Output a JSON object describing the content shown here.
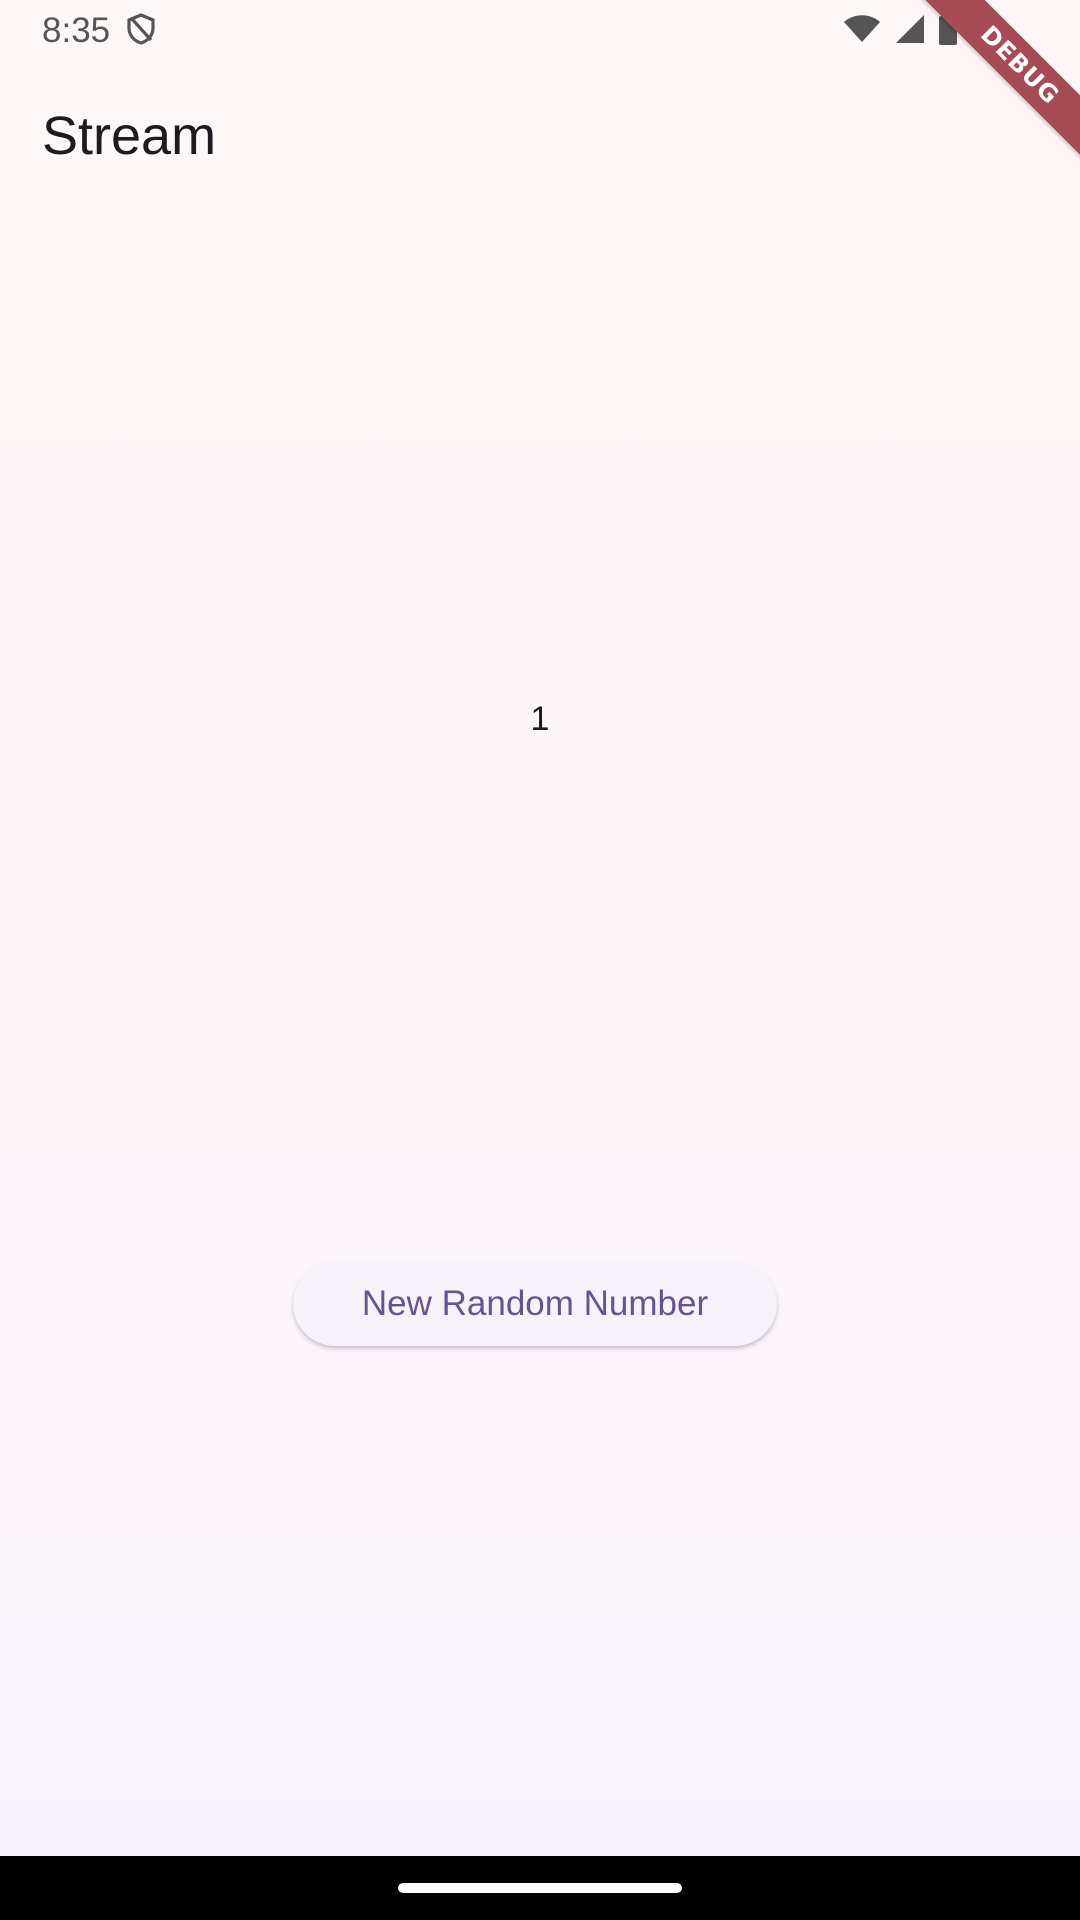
{
  "status_bar": {
    "time": "8:35",
    "icons": [
      "shield-icon",
      "wifi-icon",
      "signal-icon",
      "battery-icon"
    ]
  },
  "debug_banner": {
    "label": "DEBUG",
    "color": "#a74b55"
  },
  "app_bar": {
    "title": "Stream"
  },
  "main": {
    "number_value": "1",
    "button_label": "New Random Number"
  },
  "colors": {
    "button_text": "#65558f",
    "background": "#fdf7f8"
  }
}
